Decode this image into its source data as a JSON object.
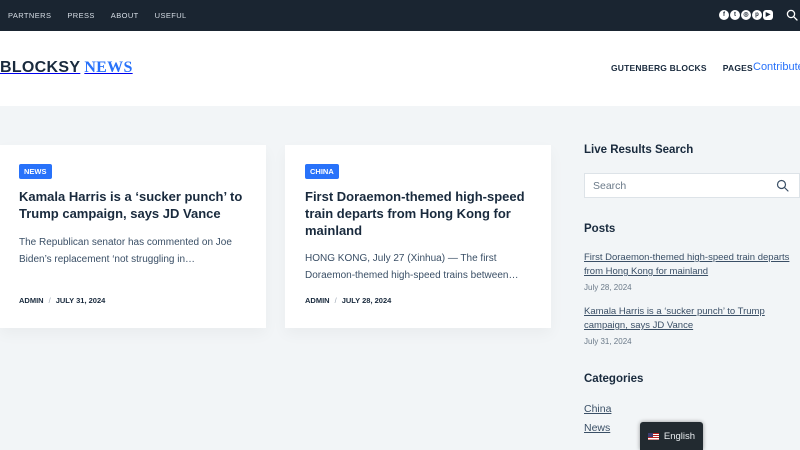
{
  "topbar": {
    "nav": [
      "PARTNERS",
      "PRESS",
      "ABOUT",
      "USEFUL"
    ],
    "social_icons": [
      "facebook-icon",
      "twitter-icon",
      "instagram-icon",
      "pinterest-icon",
      "youtube-icon"
    ],
    "search_icon": "search-icon"
  },
  "header": {
    "logo_part1": "BLOCKSY",
    "logo_part2": "NEWS",
    "nav": [
      "GUTENBERG BLOCKS",
      "PAGES"
    ],
    "contribute": "Contribute"
  },
  "posts": [
    {
      "category": "NEWS",
      "title": "Kamala Harris is a ‘sucker punch’ to Trump campaign, says JD Vance",
      "excerpt": "The Republican senator has commented on Joe Biden’s replacement ‘not struggling in…",
      "author": "ADMIN",
      "date": "JULY 31, 2024"
    },
    {
      "category": "CHINA",
      "title": "First Doraemon-themed high-speed train departs from Hong Kong for mainland",
      "excerpt": "HONG KONG, July 27 (Xinhua) — The first Doraemon-themed high-speed trains between…",
      "author": "ADMIN",
      "date": "JULY 28, 2024"
    }
  ],
  "sidebar": {
    "search_heading": "Live Results Search",
    "search_placeholder": "Search",
    "posts_heading": "Posts",
    "recent_posts": [
      {
        "title": "First Doraemon-themed high-speed train departs from Hong Kong for mainland",
        "date": "July 28, 2024"
      },
      {
        "title": "Kamala Harris is a ‘sucker punch’ to Trump campaign, says JD Vance",
        "date": "July 31, 2024"
      }
    ],
    "categories_heading": "Categories",
    "categories": [
      "China",
      "News"
    ]
  },
  "language": {
    "label": "English",
    "flag": "us-flag-icon"
  },
  "colors": {
    "accent": "#2872fa",
    "topbar": "#1a2531",
    "heading": "#192a3d",
    "text": "#3a4f66"
  }
}
